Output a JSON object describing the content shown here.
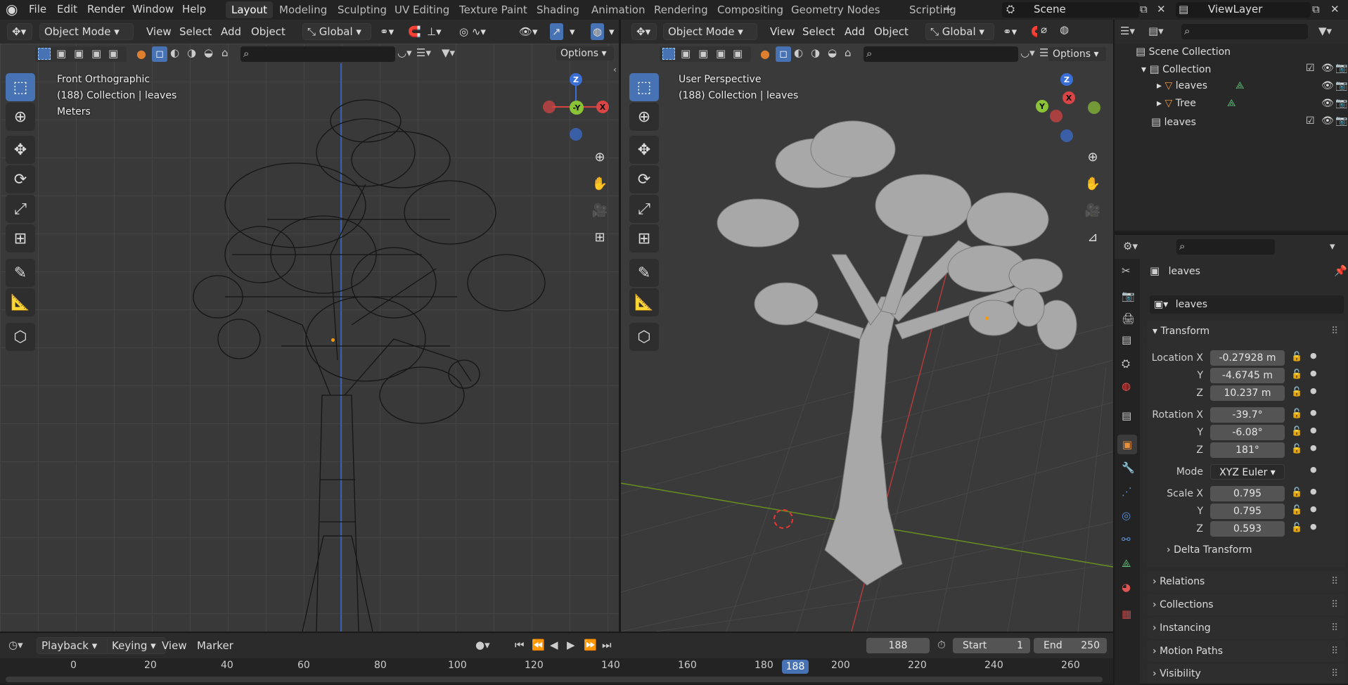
{
  "topbar": {
    "menus": [
      "File",
      "Edit",
      "Render",
      "Window",
      "Help"
    ],
    "workspaces": [
      "Layout",
      "Modeling",
      "Sculpting",
      "UV Editing",
      "Texture Paint",
      "Shading",
      "Animation",
      "Rendering",
      "Compositing",
      "Geometry Nodes",
      "Scripting"
    ],
    "active_workspace": "Layout",
    "add_tab": "+",
    "scene": "Scene",
    "view_layer": "ViewLayer"
  },
  "viewport_left": {
    "mode": "Object Mode",
    "menus": [
      "View",
      "Select",
      "Add",
      "Object"
    ],
    "orientation": "Global",
    "options": "Options",
    "view_name": "Front Orthographic",
    "collection_info": "(188) Collection | leaves",
    "units": "Meters",
    "gizmo": {
      "z": "Z",
      "y": "-Y",
      "x": "X"
    }
  },
  "viewport_right": {
    "mode": "Object Mode",
    "menus": [
      "View",
      "Select",
      "Add",
      "Object"
    ],
    "orientation": "Global",
    "options": "Options",
    "view_name": "User Perspective",
    "collection_info": "(188) Collection | leaves",
    "gizmo": {
      "z": "Z",
      "y": "Y",
      "x": "X"
    }
  },
  "outliner": {
    "scene_collection": "Scene Collection",
    "items": [
      {
        "name": "Collection",
        "depth": 1
      },
      {
        "name": "leaves",
        "depth": 2
      },
      {
        "name": "Tree",
        "depth": 2
      },
      {
        "name": "leaves",
        "depth": 1
      }
    ]
  },
  "properties": {
    "object_name": "leaves",
    "data_name": "leaves",
    "transform_label": "Transform",
    "location": {
      "label": "Location X",
      "x": "-0.27928 m",
      "y": "-4.6745 m",
      "z": "10.237 m"
    },
    "rotation": {
      "label": "Rotation X",
      "x": "-39.7°",
      "y": "-6.08°",
      "z": "181°"
    },
    "mode": {
      "label": "Mode",
      "value": "XYZ Euler"
    },
    "scale": {
      "label": "Scale X",
      "x": "0.795",
      "y": "0.795",
      "z": "0.593"
    },
    "axis_y": "Y",
    "axis_z": "Z",
    "delta": "Delta Transform",
    "sections": [
      "Relations",
      "Collections",
      "Instancing",
      "Motion Paths",
      "Visibility"
    ]
  },
  "timeline": {
    "menus": [
      "Playback",
      "Keying",
      "View",
      "Marker"
    ],
    "current_frame": "188",
    "start_label": "Start",
    "start": "1",
    "end_label": "End",
    "end": "250",
    "ruler": [
      "0",
      "20",
      "40",
      "60",
      "80",
      "100",
      "120",
      "140",
      "160",
      "180",
      "200",
      "220",
      "240",
      "260"
    ]
  }
}
